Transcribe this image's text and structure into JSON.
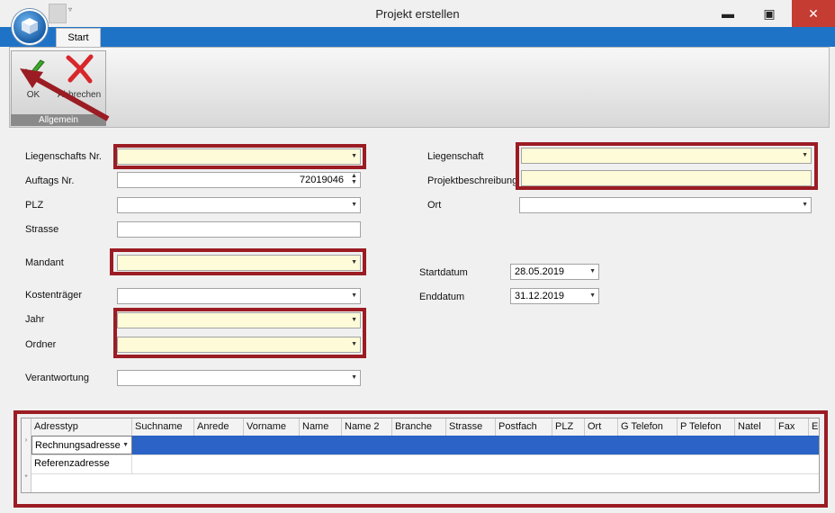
{
  "window": {
    "title": "Projekt erstellen",
    "minimize_glyph": "▬",
    "maximize_glyph": "▣",
    "close_glyph": "✕",
    "quickaccess_glyph": "▿"
  },
  "ribbon": {
    "tab_start": "Start",
    "group_label": "Allgemein",
    "ok_label": "OK",
    "cancel_label": "Abbrechen",
    "ok_icon": "checkmark-icon",
    "cancel_icon": "red-x-icon",
    "accent_color": "#1f73c7"
  },
  "form": {
    "liegenschafts_nr_label": "Liegenschafts Nr.",
    "auftags_nr_label": "Auftags Nr.",
    "auftags_nr_value": "72019046",
    "plz_label": "PLZ",
    "strasse_label": "Strasse",
    "mandant_label": "Mandant",
    "kostentraeger_label": "Kostenträger",
    "jahr_label": "Jahr",
    "ordner_label": "Ordner",
    "verantwortung_label": "Verantwortung",
    "liegenschaft_label": "Liegenschaft",
    "projektbeschreibung_label": "Projektbeschreibung",
    "ort_label": "Ort",
    "startdatum_label": "Startdatum",
    "startdatum_value": "28.05.2019",
    "enddatum_label": "Enddatum",
    "enddatum_value": "31.12.2019",
    "highlight_color": "#9b1c23",
    "required_field_color": "#fefbd8"
  },
  "grid": {
    "columns": [
      "Adresstyp",
      "Suchname",
      "Anrede",
      "Vorname",
      "Name",
      "Name 2",
      "Branche",
      "Strasse",
      "Postfach",
      "PLZ",
      "Ort",
      "G Telefon",
      "P Telefon",
      "Natel",
      "Fax",
      "E-"
    ],
    "rows": [
      {
        "adresstyp": "Rechnungsadresse"
      },
      {
        "adresstyp": "Referenzadresse"
      }
    ],
    "selected_row_color": "#2b63c6"
  }
}
